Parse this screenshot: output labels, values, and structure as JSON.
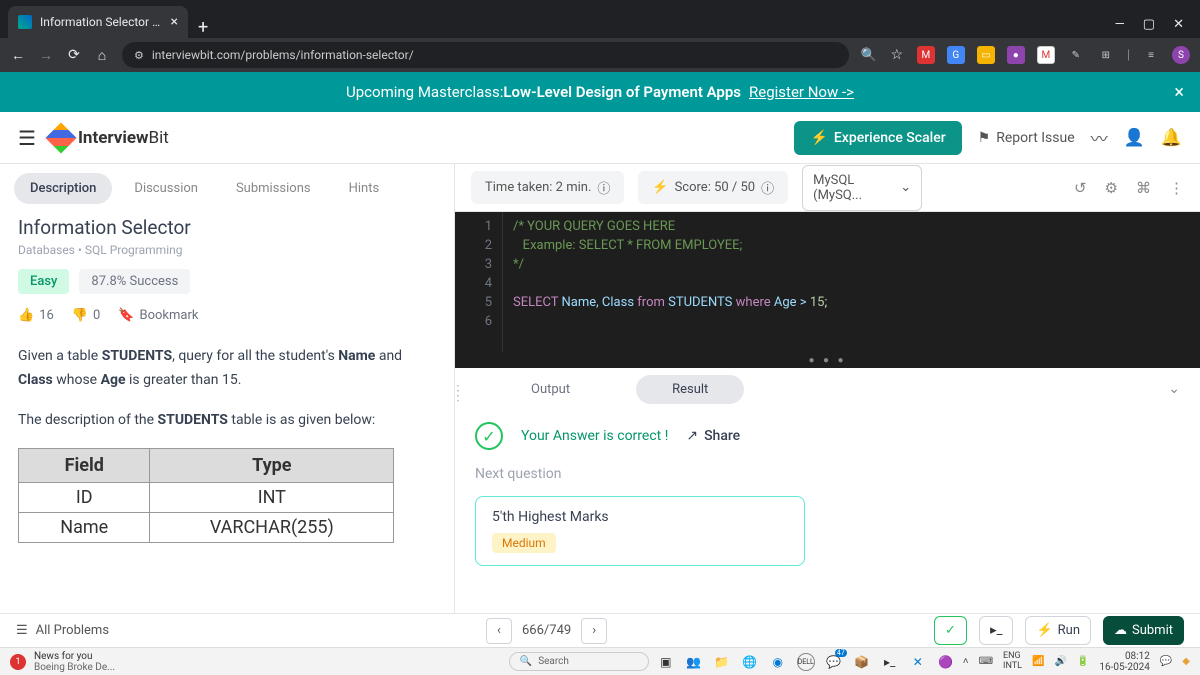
{
  "browser": {
    "tab_title": "Information Selector | Interview...",
    "url": "interviewbit.com/problems/information-selector/"
  },
  "banner": {
    "prefix": "Upcoming Masterclass: ",
    "bold": "Low-Level Design of Payment Apps",
    "link": "Register Now ->"
  },
  "header": {
    "logo_a": "Interview",
    "logo_b": "Bit",
    "scaler_btn": "Experience Scaler",
    "report": "Report Issue"
  },
  "left_tabs": [
    "Description",
    "Discussion",
    "Submissions",
    "Hints"
  ],
  "problem": {
    "title": "Information Selector",
    "tags": "Databases  •  SQL Programming",
    "difficulty": "Easy",
    "success": "87.8% Success",
    "upvotes": "16",
    "downvotes": "0",
    "bookmark": "Bookmark",
    "desc_1a": "Given a table ",
    "desc_1b": "STUDENTS",
    "desc_1c": ", query for all the student's ",
    "desc_1d": "Name",
    "desc_1e": " and ",
    "desc_1f": "Class",
    "desc_1g": " whose ",
    "desc_1h": "Age",
    "desc_1i": " is greater than 15.",
    "desc_2a": "The description of the ",
    "desc_2b": "STUDENTS",
    "desc_2c": " table is as given below:",
    "table": {
      "h1": "Field",
      "h2": "Type",
      "r1c1": "ID",
      "r1c2": "INT",
      "r2c1": "Name",
      "r2c2": "VARCHAR(255)"
    }
  },
  "editor_bar": {
    "time": "Time taken: 2 min.",
    "score": "Score:  50  /  50",
    "lang": "MySQL (MySQ..."
  },
  "code": {
    "l1": "/* YOUR QUERY GOES HERE",
    "l2": "   Example: SELECT * FROM EMPLOYEE;",
    "l3": "*/",
    "l5_kw1": "SELECT",
    "l5_cols": " Name, Class ",
    "l5_kw2": "from",
    "l5_tbl": " STUDENTS ",
    "l5_kw3": "where",
    "l5_cond": " Age > ",
    "l5_num": "15",
    "l5_semi": ";"
  },
  "output": {
    "tab1": "Output",
    "tab2": "Result",
    "correct": "Your Answer is correct !",
    "share": "Share",
    "next_label": "Next question",
    "next_title": "5'th Highest Marks",
    "next_diff": "Medium"
  },
  "footer": {
    "all": "All Problems",
    "pager": "666/749",
    "run": "Run",
    "submit": "Submit"
  },
  "taskbar": {
    "news1": "News for you",
    "news2": "Boeing Broke De...",
    "search": "Search",
    "lang1": "ENG",
    "lang2": "INTL",
    "time": "08:12",
    "date": "16-05-2024"
  }
}
